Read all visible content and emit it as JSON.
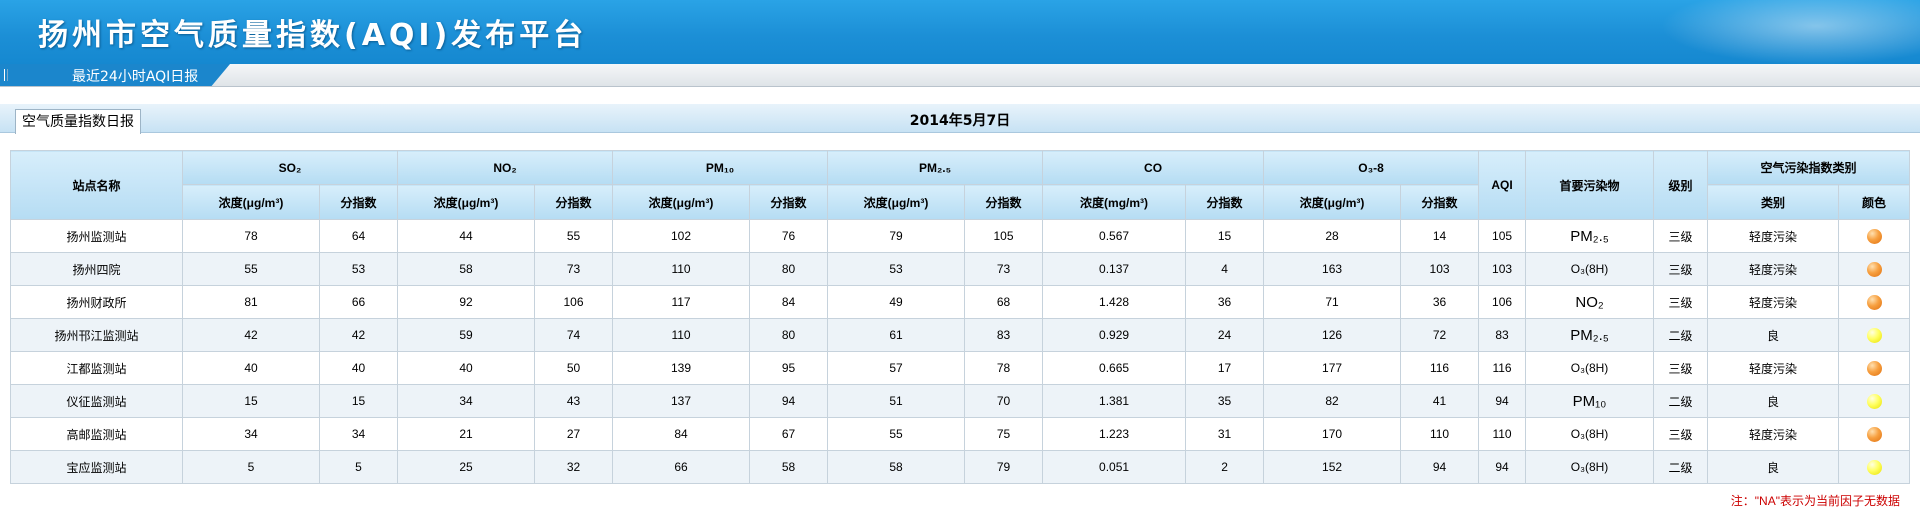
{
  "header": {
    "title": "扬州市空气质量指数(AQI)发布平台",
    "subtab": "最近24小时AQI日报"
  },
  "panel": {
    "tab": "空气质量指数日报",
    "date": "2014年5月7日"
  },
  "table": {
    "station_header": "站点名称",
    "pollutants": [
      {
        "name": "SO₂"
      },
      {
        "name": "NO₂"
      },
      {
        "name": "PM₁₀"
      },
      {
        "name": "PM₂.₅"
      },
      {
        "name": "CO"
      },
      {
        "name": "O₃-8"
      }
    ],
    "conc_ug": "浓度(μg/m³)",
    "conc_mg": "浓度(mg/m³)",
    "sub_index": "分指数",
    "aqi": "AQI",
    "primary": "首要污染物",
    "level": "级别",
    "category_group": "空气污染指数类别",
    "category": "类别",
    "color": "颜色",
    "rows": [
      {
        "station": "扬州监测站",
        "so2": "78",
        "so2_i": "64",
        "no2": "44",
        "no2_i": "55",
        "pm10": "102",
        "pm10_i": "76",
        "pm25": "79",
        "pm25_i": "105",
        "co": "0.567",
        "co_i": "15",
        "o3": "28",
        "o3_i": "14",
        "aqi": "105",
        "primary": "PM₂.₅",
        "level": "三级",
        "category": "轻度污染",
        "color": "orange"
      },
      {
        "station": "扬州四院",
        "so2": "55",
        "so2_i": "53",
        "no2": "58",
        "no2_i": "73",
        "pm10": "110",
        "pm10_i": "80",
        "pm25": "53",
        "pm25_i": "73",
        "co": "0.137",
        "co_i": "4",
        "o3": "163",
        "o3_i": "103",
        "aqi": "103",
        "primary": "O₃(8H)",
        "level": "三级",
        "category": "轻度污染",
        "color": "orange"
      },
      {
        "station": "扬州财政所",
        "so2": "81",
        "so2_i": "66",
        "no2": "92",
        "no2_i": "106",
        "pm10": "117",
        "pm10_i": "84",
        "pm25": "49",
        "pm25_i": "68",
        "co": "1.428",
        "co_i": "36",
        "o3": "71",
        "o3_i": "36",
        "aqi": "106",
        "primary": "NO₂",
        "level": "三级",
        "category": "轻度污染",
        "color": "orange"
      },
      {
        "station": "扬州邗江监测站",
        "so2": "42",
        "so2_i": "42",
        "no2": "59",
        "no2_i": "74",
        "pm10": "110",
        "pm10_i": "80",
        "pm25": "61",
        "pm25_i": "83",
        "co": "0.929",
        "co_i": "24",
        "o3": "126",
        "o3_i": "72",
        "aqi": "83",
        "primary": "PM₂.₅",
        "level": "二级",
        "category": "良",
        "color": "yellow"
      },
      {
        "station": "江都监测站",
        "so2": "40",
        "so2_i": "40",
        "no2": "40",
        "no2_i": "50",
        "pm10": "139",
        "pm10_i": "95",
        "pm25": "57",
        "pm25_i": "78",
        "co": "0.665",
        "co_i": "17",
        "o3": "177",
        "o3_i": "116",
        "aqi": "116",
        "primary": "O₃(8H)",
        "level": "三级",
        "category": "轻度污染",
        "color": "orange"
      },
      {
        "station": "仪征监测站",
        "so2": "15",
        "so2_i": "15",
        "no2": "34",
        "no2_i": "43",
        "pm10": "137",
        "pm10_i": "94",
        "pm25": "51",
        "pm25_i": "70",
        "co": "1.381",
        "co_i": "35",
        "o3": "82",
        "o3_i": "41",
        "aqi": "94",
        "primary": "PM₁₀",
        "level": "二级",
        "category": "良",
        "color": "yellow"
      },
      {
        "station": "高邮监测站",
        "so2": "34",
        "so2_i": "34",
        "no2": "21",
        "no2_i": "27",
        "pm10": "84",
        "pm10_i": "67",
        "pm25": "55",
        "pm25_i": "75",
        "co": "1.223",
        "co_i": "31",
        "o3": "170",
        "o3_i": "110",
        "aqi": "110",
        "primary": "O₃(8H)",
        "level": "三级",
        "category": "轻度污染",
        "color": "orange"
      },
      {
        "station": "宝应监测站",
        "so2": "5",
        "so2_i": "5",
        "no2": "25",
        "no2_i": "32",
        "pm10": "66",
        "pm10_i": "58",
        "pm25": "58",
        "pm25_i": "79",
        "co": "0.051",
        "co_i": "2",
        "o3": "152",
        "o3_i": "94",
        "aqi": "94",
        "primary": "O₃(8H)",
        "level": "二级",
        "category": "良",
        "color": "yellow"
      }
    ]
  },
  "note": "注：\"NA\"表示为当前因子无数据"
}
